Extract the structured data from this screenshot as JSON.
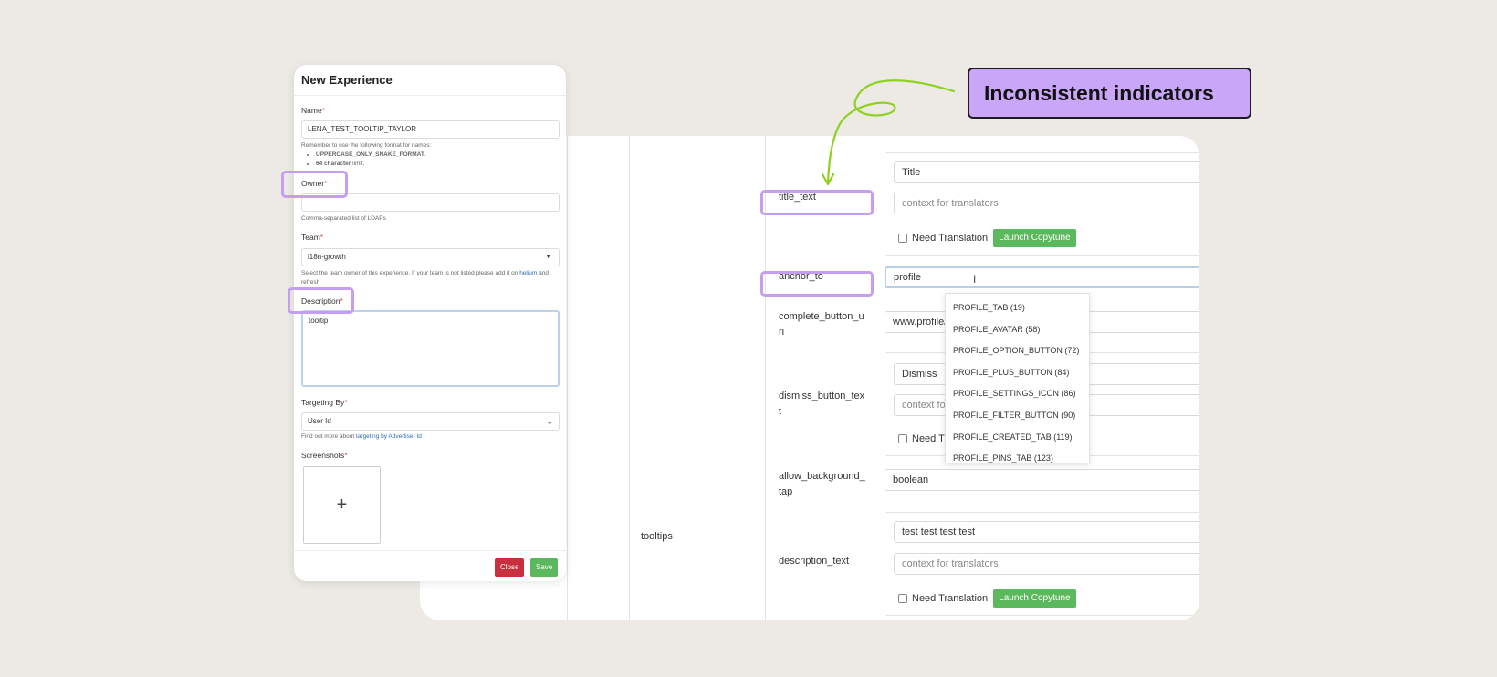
{
  "callout": {
    "text": "Inconsistent indicators"
  },
  "table": {
    "section_label": "tooltips",
    "fields": {
      "title_text": {
        "label": "title_text",
        "value": "Title",
        "context_placeholder": "context for translators",
        "need_translation_label": "Need Translation",
        "launch_button": "Launch Copytune"
      },
      "anchor_to": {
        "label": "anchor_to",
        "value": "profile"
      },
      "complete_button_uri": {
        "label": "complete_button_uri",
        "value": "www.profile/"
      },
      "dismiss_button_text": {
        "label": "dismiss_button_text",
        "value": "Dismiss",
        "context_placeholder": "context fo",
        "need_translation_label": "Need Tr"
      },
      "allow_background_tap": {
        "label": "allow_background_tap",
        "value": "boolean"
      },
      "description_text": {
        "label": "description_text",
        "value": "test test test test",
        "context_placeholder": "context for translators",
        "need_translation_label": "Need Translation",
        "launch_button": "Launch Copytune"
      }
    },
    "dropdown_options": [
      "PROFILE_TAB (19)",
      "PROFILE_AVATAR (58)",
      "PROFILE_OPTION_BUTTON (72)",
      "PROFILE_PLUS_BUTTON (84)",
      "PROFILE_SETTINGS_ICON (86)",
      "PROFILE_FILTER_BUTTON (90)",
      "PROFILE_CREATED_TAB (119)",
      "PROFILE_PINS_TAB (123)"
    ]
  },
  "modal": {
    "title": "New Experience",
    "required_marker": "*",
    "name": {
      "label": "Name",
      "value": "LENA_TEST_TOOLTIP_TAYLOR",
      "help_intro": "Remember to use the following format for names:",
      "rule1_bold": "UPPERCASE_ONLY_SNAKE_FORMAT",
      "rule1_rest": ".",
      "rule2_bold": "64 character",
      "rule2_rest": " limit."
    },
    "owner": {
      "label": "Owner",
      "value": "",
      "help": "Comma-separated list of LDAPs"
    },
    "team": {
      "label": "Team",
      "value": "i18n-growth",
      "help_pre": "Select the team owner of this experience. If your team is not listed please add it on ",
      "help_link": "helium",
      "help_post": " and refresh"
    },
    "description": {
      "label": "Description",
      "value": "tooltip"
    },
    "targeting": {
      "label": "Targeting By",
      "value": "User Id",
      "help_pre": "Find out more about ",
      "help_link": "targeting by Advertiser Id"
    },
    "screenshots": {
      "label": "Screenshots"
    },
    "close_button": "Close",
    "save_button": "Save"
  },
  "colors": {
    "background": "#edeae6",
    "highlight": "#c59ef0",
    "callout_fill": "#c9a6f8",
    "arrow": "#8fd11f",
    "launch_green": "#5cb85c",
    "close_red": "#c9303e",
    "save_green": "#5cb85c",
    "required_red": "#d9534f"
  }
}
